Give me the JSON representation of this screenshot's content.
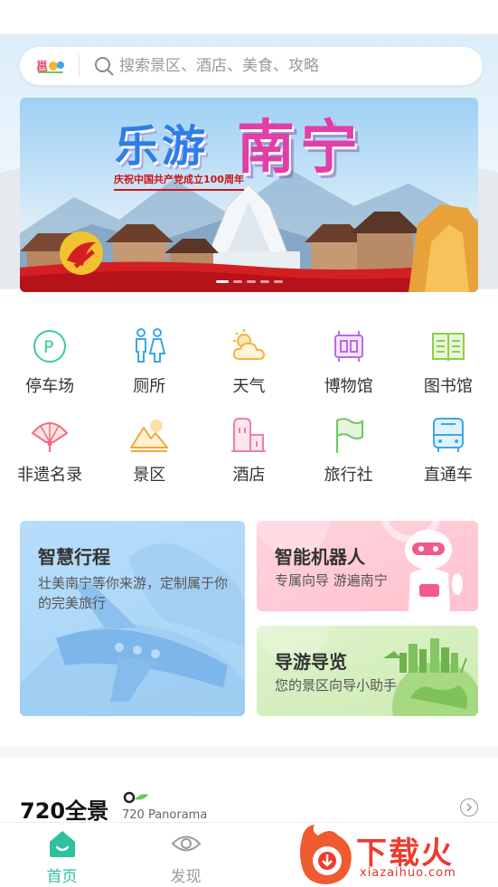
{
  "search": {
    "placeholder": "搜索景区、酒店、美食、攻略",
    "logo_icon": "city-logo-icon"
  },
  "banner": {
    "title_part1": "乐游",
    "title_part2": "南宁",
    "subtitle": "庆祝中国共产党成立100周年",
    "slides_count": 5,
    "active_slide": 1
  },
  "quick_links": [
    {
      "label": "停车场",
      "icon": "parking-icon",
      "color": "#3cc9a4"
    },
    {
      "label": "厕所",
      "icon": "restroom-icon",
      "color": "#3aa7e8"
    },
    {
      "label": "天气",
      "icon": "weather-icon",
      "color": "#f6b33c"
    },
    {
      "label": "博物馆",
      "icon": "museum-icon",
      "color": "#b96ce0"
    },
    {
      "label": "图书馆",
      "icon": "library-icon",
      "color": "#8ccf4a"
    },
    {
      "label": "非遗名录",
      "icon": "heritage-fan-icon",
      "color": "#f06d7b"
    },
    {
      "label": "景区",
      "icon": "scenic-mountain-icon",
      "color": "#f4a73c"
    },
    {
      "label": "酒店",
      "icon": "hotel-icon",
      "color": "#f07fa0"
    },
    {
      "label": "旅行社",
      "icon": "travel-agency-flag-icon",
      "color": "#6cc860"
    },
    {
      "label": "直通车",
      "icon": "bus-icon",
      "color": "#3aa7e8"
    }
  ],
  "cards": {
    "trip": {
      "title": "智慧行程",
      "desc": "壮美南宁等你来游，定制属于你的完美旅行"
    },
    "robot": {
      "title": "智能机器人",
      "desc": "专属向导 游遍南宁"
    },
    "guide": {
      "title": "导游导览",
      "desc": "您的景区向导小助手"
    }
  },
  "panorama": {
    "title": "720全景",
    "subtitle": "720 Panorama"
  },
  "tabs": [
    {
      "label": "首页",
      "icon": "home-icon",
      "active": true
    },
    {
      "label": "发现",
      "icon": "eye-icon",
      "active": false
    }
  ],
  "watermark": {
    "text": "下载火",
    "url": "xiazaihuo.com"
  },
  "colors": {
    "accent": "#2fc0a0",
    "tab_inactive": "#9b9b9b"
  }
}
